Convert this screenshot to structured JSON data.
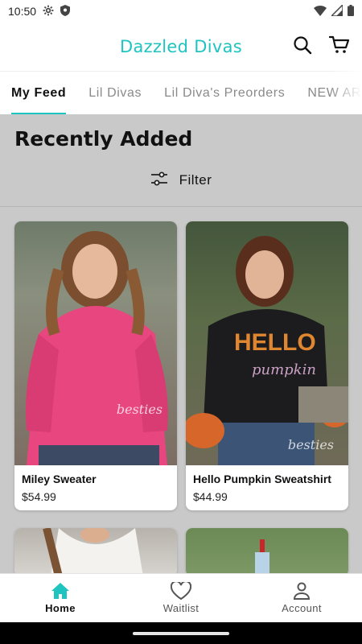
{
  "status_bar": {
    "time": "10:50"
  },
  "header": {
    "title": "Dazzled Divas"
  },
  "tabs": [
    {
      "label": "My Feed",
      "active": true
    },
    {
      "label": "Lil Divas",
      "active": false
    },
    {
      "label": "Lil Diva's Preorders",
      "active": false
    },
    {
      "label": "NEW AR",
      "active": false
    }
  ],
  "section": {
    "title": "Recently Added",
    "filter_label": "Filter"
  },
  "products": [
    {
      "name": "Miley Sweater",
      "price": "$54.99",
      "watermark": "besties"
    },
    {
      "name": "Hello Pumpkin Sweatshirt",
      "price": "$44.99",
      "watermark": "besties"
    }
  ],
  "bottom_nav": [
    {
      "label": "Home",
      "icon": "home-icon",
      "active": true
    },
    {
      "label": "Waitlist",
      "icon": "heart-icon",
      "active": false
    },
    {
      "label": "Account",
      "icon": "account-icon",
      "active": false
    }
  ],
  "colors": {
    "accent": "#1fc4c1",
    "overlay": "#c9c9c9"
  }
}
